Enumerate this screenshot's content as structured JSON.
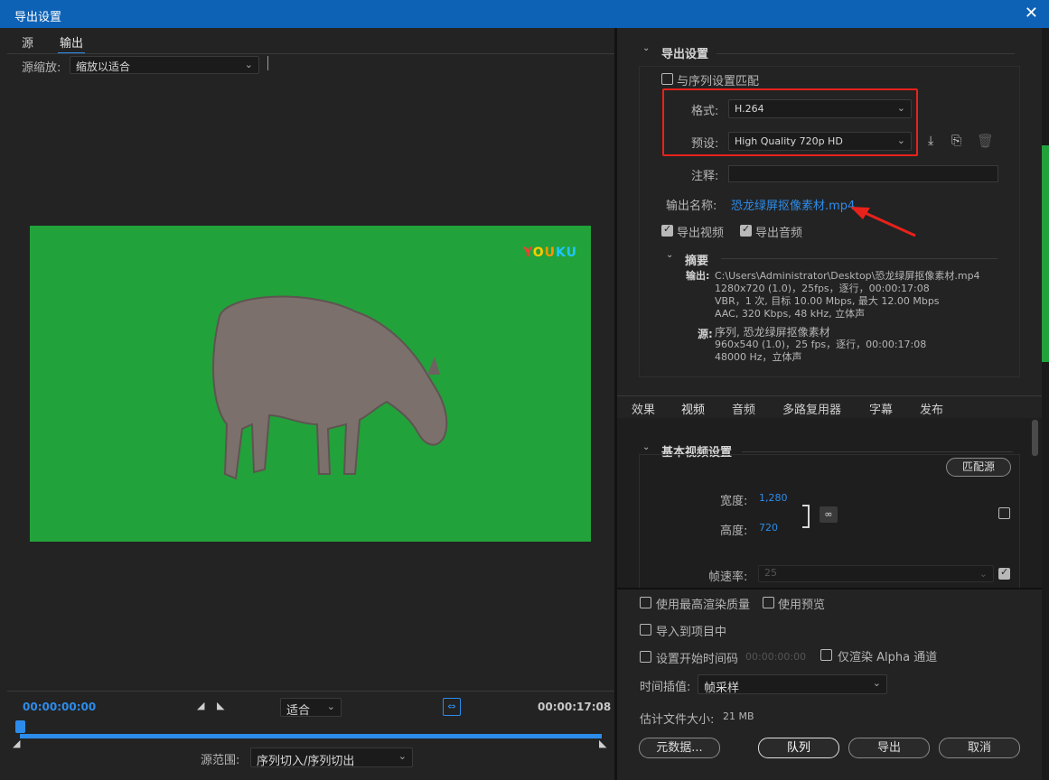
{
  "window": {
    "title": "导出设置",
    "close": "✕"
  },
  "left": {
    "tabs": [
      "源",
      "输出"
    ],
    "scale_label": "源缩放:",
    "scale_value": "缩放以适合",
    "watermark": [
      "Y",
      "O",
      "U",
      "K",
      "U"
    ],
    "time_start": "00:00:00:00",
    "time_end": "00:00:17:08",
    "fit_value": "适合",
    "range_label": "源范围:",
    "range_value": "序列切入/序列切出"
  },
  "export": {
    "section_title": "导出设置",
    "match_sequence": "与序列设置匹配",
    "format_label": "格式:",
    "format_value": "H.264",
    "preset_label": "预设:",
    "preset_value": "High Quality 720p HD",
    "comment_label": "注释:",
    "output_name_label": "输出名称:",
    "output_name": "恐龙绿屏抠像素材.mp4",
    "export_video": "导出视频",
    "export_audio": "导出音频"
  },
  "summary": {
    "title": "摘要",
    "output_label": "输出:",
    "output_lines": [
      "C:\\Users\\Administrator\\Desktop\\恐龙绿屏抠像素材.mp4",
      "1280x720 (1.0)，25fps，逐行，00:00:17:08",
      "VBR，1 次, 目标 10.00 Mbps, 最大 12.00 Mbps",
      "AAC, 320 Kbps, 48 kHz, 立体声"
    ],
    "source_label": "源:",
    "source_lines": [
      "序列, 恐龙绿屏抠像素材",
      "960x540 (1.0)，25 fps，逐行，00:00:17:08",
      "48000 Hz，立体声"
    ]
  },
  "tabs2": [
    "效果",
    "视频",
    "音频",
    "多路复用器",
    "字幕",
    "发布"
  ],
  "video": {
    "section_title": "基本视频设置",
    "match_source": "匹配源",
    "width_label": "宽度:",
    "width_value": "1,280",
    "height_label": "高度:",
    "height_value": "720",
    "fps_label": "帧速率:",
    "fps_value": "25"
  },
  "bottom": {
    "max_render": "使用最高渲染质量",
    "use_preview": "使用预览",
    "import_project": "导入到项目中",
    "set_timecode": "设置开始时间码",
    "timecode_value": "00:00:00:00",
    "alpha_only": "仅渲染 Alpha 通道",
    "interp_label": "时间插值:",
    "interp_value": "帧采样",
    "filesize_label": "估计文件大小:",
    "filesize_value": "21 MB",
    "metadata": "元数据...",
    "queue": "队列",
    "export": "导出",
    "cancel": "取消"
  }
}
